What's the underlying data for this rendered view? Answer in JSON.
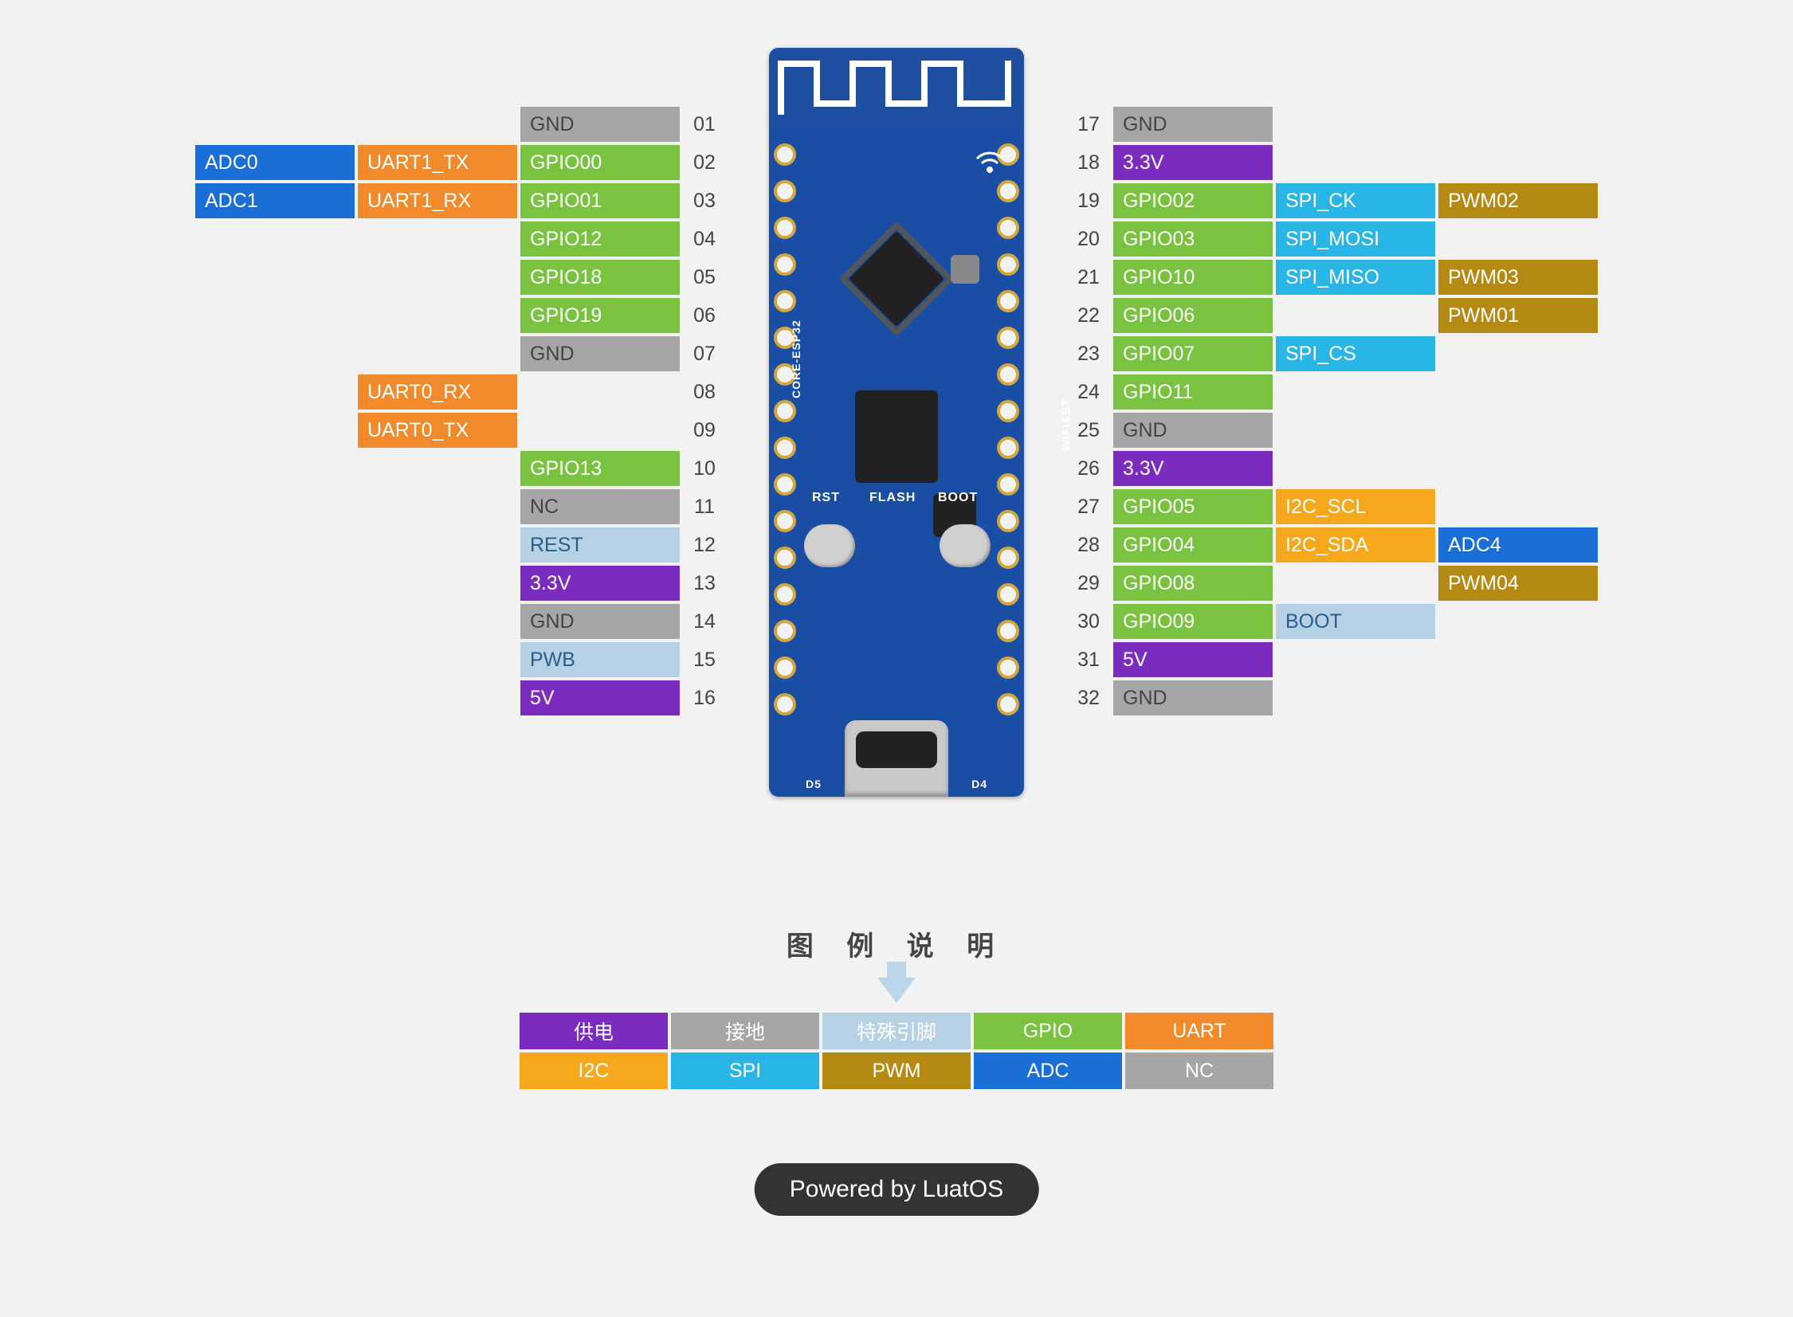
{
  "board": {
    "silkscreen": {
      "rst": "RST",
      "flash": "FLASH",
      "boot": "BOOT",
      "name": "CORE-ESP32",
      "wifi": "WIFI&BT",
      "d5": "D5",
      "d4": "D4"
    }
  },
  "left": [
    {
      "num": "01",
      "cells": [
        {
          "txt": "GND",
          "cls": "c-gnd"
        }
      ]
    },
    {
      "num": "02",
      "cells": [
        {
          "txt": "ADC0",
          "cls": "c-adc"
        },
        {
          "txt": "UART1_TX",
          "cls": "c-uart"
        },
        {
          "txt": "GPIO00",
          "cls": "c-gpio"
        }
      ]
    },
    {
      "num": "03",
      "cells": [
        {
          "txt": "ADC1",
          "cls": "c-adc"
        },
        {
          "txt": "UART1_RX",
          "cls": "c-uart"
        },
        {
          "txt": "GPIO01",
          "cls": "c-gpio"
        }
      ]
    },
    {
      "num": "04",
      "cells": [
        {
          "txt": "GPIO12",
          "cls": "c-gpio"
        }
      ]
    },
    {
      "num": "05",
      "cells": [
        {
          "txt": "GPIO18",
          "cls": "c-gpio"
        }
      ]
    },
    {
      "num": "06",
      "cells": [
        {
          "txt": "GPIO19",
          "cls": "c-gpio"
        }
      ]
    },
    {
      "num": "07",
      "cells": [
        {
          "txt": "GND",
          "cls": "c-gnd"
        }
      ]
    },
    {
      "num": "08",
      "cells": [
        {
          "txt": "UART0_RX",
          "cls": "c-uart"
        },
        {
          "txt": "",
          "cls": "spacer"
        }
      ]
    },
    {
      "num": "09",
      "cells": [
        {
          "txt": "UART0_TX",
          "cls": "c-uart"
        },
        {
          "txt": "",
          "cls": "spacer"
        }
      ]
    },
    {
      "num": "10",
      "cells": [
        {
          "txt": "GPIO13",
          "cls": "c-gpio"
        }
      ]
    },
    {
      "num": "11",
      "cells": [
        {
          "txt": "NC",
          "cls": "c-nc"
        }
      ]
    },
    {
      "num": "12",
      "cells": [
        {
          "txt": "REST",
          "cls": "c-special"
        }
      ]
    },
    {
      "num": "13",
      "cells": [
        {
          "txt": "3.3V",
          "cls": "c-pwr"
        }
      ]
    },
    {
      "num": "14",
      "cells": [
        {
          "txt": "GND",
          "cls": "c-gnd"
        }
      ]
    },
    {
      "num": "15",
      "cells": [
        {
          "txt": "PWB",
          "cls": "c-special"
        }
      ]
    },
    {
      "num": "16",
      "cells": [
        {
          "txt": "5V",
          "cls": "c-pwr"
        }
      ]
    }
  ],
  "right": [
    {
      "num": "17",
      "cells": [
        {
          "txt": "GND",
          "cls": "c-gnd"
        }
      ]
    },
    {
      "num": "18",
      "cells": [
        {
          "txt": "3.3V",
          "cls": "c-pwr"
        }
      ]
    },
    {
      "num": "19",
      "cells": [
        {
          "txt": "GPIO02",
          "cls": "c-gpio"
        },
        {
          "txt": "SPI_CK",
          "cls": "c-spi"
        },
        {
          "txt": "PWM02",
          "cls": "c-pwm"
        }
      ]
    },
    {
      "num": "20",
      "cells": [
        {
          "txt": "GPIO03",
          "cls": "c-gpio"
        },
        {
          "txt": "SPI_MOSI",
          "cls": "c-spi"
        }
      ]
    },
    {
      "num": "21",
      "cells": [
        {
          "txt": "GPIO10",
          "cls": "c-gpio"
        },
        {
          "txt": "SPI_MISO",
          "cls": "c-spi"
        },
        {
          "txt": "PWM03",
          "cls": "c-pwm"
        }
      ]
    },
    {
      "num": "22",
      "cells": [
        {
          "txt": "GPIO06",
          "cls": "c-gpio"
        },
        {
          "txt": "",
          "cls": "spacer"
        },
        {
          "txt": "PWM01",
          "cls": "c-pwm"
        }
      ]
    },
    {
      "num": "23",
      "cells": [
        {
          "txt": "GPIO07",
          "cls": "c-gpio"
        },
        {
          "txt": "SPI_CS",
          "cls": "c-spi"
        }
      ]
    },
    {
      "num": "24",
      "cells": [
        {
          "txt": "GPIO11",
          "cls": "c-gpio"
        }
      ]
    },
    {
      "num": "25",
      "cells": [
        {
          "txt": "GND",
          "cls": "c-gnd"
        }
      ]
    },
    {
      "num": "26",
      "cells": [
        {
          "txt": "3.3V",
          "cls": "c-pwr"
        }
      ]
    },
    {
      "num": "27",
      "cells": [
        {
          "txt": "GPIO05",
          "cls": "c-gpio"
        },
        {
          "txt": "I2C_SCL",
          "cls": "c-i2c"
        }
      ]
    },
    {
      "num": "28",
      "cells": [
        {
          "txt": "GPIO04",
          "cls": "c-gpio"
        },
        {
          "txt": "I2C_SDA",
          "cls": "c-i2c"
        },
        {
          "txt": "ADC4",
          "cls": "c-adc"
        }
      ]
    },
    {
      "num": "29",
      "cells": [
        {
          "txt": "GPIO08",
          "cls": "c-gpio"
        },
        {
          "txt": "",
          "cls": "spacer"
        },
        {
          "txt": "PWM04",
          "cls": "c-pwm"
        }
      ]
    },
    {
      "num": "30",
      "cells": [
        {
          "txt": "GPIO09",
          "cls": "c-gpio"
        },
        {
          "txt": "BOOT",
          "cls": "c-boot"
        }
      ]
    },
    {
      "num": "31",
      "cells": [
        {
          "txt": "5V",
          "cls": "c-pwr"
        }
      ]
    },
    {
      "num": "32",
      "cells": [
        {
          "txt": "GND",
          "cls": "c-gnd"
        }
      ]
    }
  ],
  "legend": {
    "title": "图 例 说 明",
    "rows": [
      [
        {
          "txt": "供电",
          "cls": "c-pwr"
        },
        {
          "txt": "接地",
          "cls": "c-gnd"
        },
        {
          "txt": "特殊引脚",
          "cls": "c-special"
        },
        {
          "txt": "GPIO",
          "cls": "c-gpio"
        },
        {
          "txt": "UART",
          "cls": "c-uart"
        }
      ],
      [
        {
          "txt": "I2C",
          "cls": "c-i2c"
        },
        {
          "txt": "SPI",
          "cls": "c-spi"
        },
        {
          "txt": "PWM",
          "cls": "c-pwm"
        },
        {
          "txt": "ADC",
          "cls": "c-adc"
        },
        {
          "txt": "NC",
          "cls": "c-nc"
        }
      ]
    ]
  },
  "footer": "Powered by LuatOS"
}
